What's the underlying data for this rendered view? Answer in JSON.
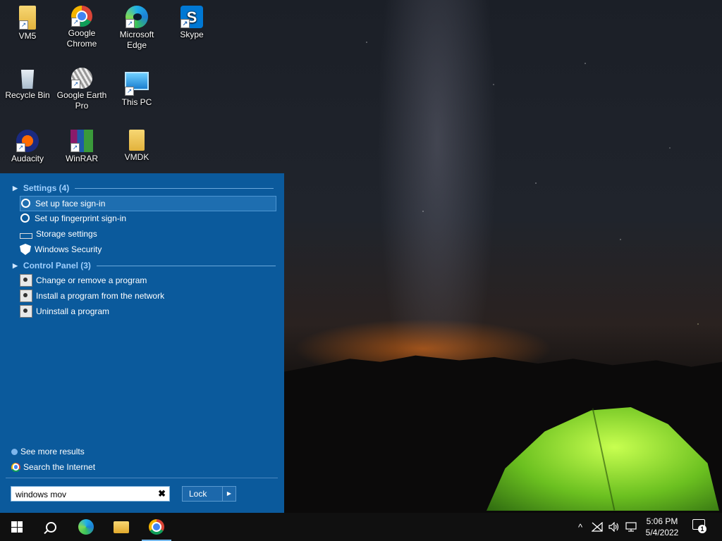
{
  "desktop": {
    "icons": [
      {
        "label": "VM5",
        "icon": "folder-user-icon"
      },
      {
        "label": "Google Chrome",
        "icon": "chrome-icon"
      },
      {
        "label": "Microsoft Edge",
        "icon": "edge-icon"
      },
      {
        "label": "Skype",
        "icon": "skype-icon",
        "glyph": "S"
      },
      {
        "label": "Recycle Bin",
        "icon": "recycle-bin-icon"
      },
      {
        "label": "Google Earth Pro",
        "icon": "google-earth-icon"
      },
      {
        "label": "This PC",
        "icon": "this-pc-icon"
      },
      {
        "label": "Audacity",
        "icon": "audacity-icon"
      },
      {
        "label": "WinRAR",
        "icon": "winrar-icon"
      },
      {
        "label": "VMDK",
        "icon": "folder-icon"
      }
    ]
  },
  "search_panel": {
    "settings_header": "Settings (4)",
    "settings_items": [
      {
        "label": "Set up face sign-in",
        "icon": "key-icon",
        "selected": true
      },
      {
        "label": "Set up fingerprint sign-in",
        "icon": "key-icon",
        "selected": false
      },
      {
        "label": "Storage settings",
        "icon": "drive-icon",
        "selected": false
      },
      {
        "label": "Windows Security",
        "icon": "shield-icon",
        "selected": false
      }
    ],
    "control_panel_header": "Control Panel (3)",
    "control_panel_items": [
      {
        "label": "Change or remove a program",
        "icon": "control-panel-icon"
      },
      {
        "label": "Install a program from the network",
        "icon": "control-panel-icon"
      },
      {
        "label": "Uninstall a program",
        "icon": "control-panel-icon"
      }
    ],
    "see_more": "See more results",
    "search_internet": "Search the Internet",
    "search_value": "windows mov",
    "clear_glyph": "✖",
    "lock_label": "Lock",
    "lock_arrow": "▶"
  },
  "taskbar": {
    "time": "5:06 PM",
    "date": "5/4/2022",
    "tray_chevron": "^",
    "notification_count": "1"
  }
}
